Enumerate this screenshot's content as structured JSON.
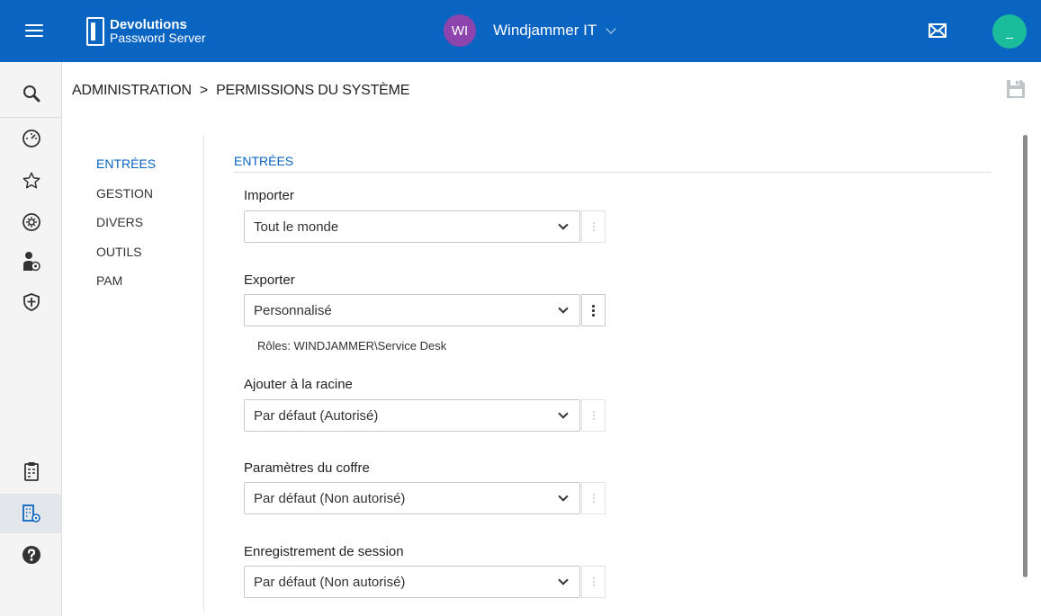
{
  "header": {
    "logo_line1": "Devolutions",
    "logo_line2": "Password Server",
    "org_initials": "WI",
    "org_name": "Windjammer IT"
  },
  "icons": {
    "menu": "hamburger-menu-icon",
    "mail": "mail-icon",
    "search": "search-icon",
    "dashboard": "dashboard-icon",
    "favorites": "star-icon",
    "settings": "gear-icon",
    "users": "user-settings-icon",
    "security": "shield-icon",
    "reports": "clipboard-icon",
    "administration": "building-gear-icon",
    "help": "help-icon",
    "save": "save-icon"
  },
  "breadcrumb": {
    "part1": "ADMINISTRATION",
    "separator": ">",
    "part2": "PERMISSIONS DU SYSTÈME"
  },
  "subnav": {
    "items": [
      "ENTRÉES",
      "GESTION",
      "DIVERS",
      "OUTILS",
      "PAM"
    ],
    "active": "ENTRÉES"
  },
  "section": {
    "title": "ENTRÉES"
  },
  "fields": [
    {
      "label": "Importer",
      "value": "Tout le monde",
      "menu_enabled": false
    },
    {
      "label": "Exporter",
      "value": "Personnalisé",
      "menu_enabled": true,
      "note": "Rôles: WINDJAMMER\\Service Desk"
    },
    {
      "label": "Ajouter à la racine",
      "value": "Par défaut (Autorisé)",
      "menu_enabled": false
    },
    {
      "label": "Paramètres du coffre",
      "value": "Par défaut (Non autorisé)",
      "menu_enabled": false
    },
    {
      "label": "Enregistrement de session",
      "value": "Par défaut (Non autorisé)",
      "menu_enabled": false
    }
  ],
  "colors": {
    "topbar": "#0a64c2",
    "accent": "#0a64c2",
    "org_avatar": "#8e44ad",
    "user_avatar": "#1abc9c"
  }
}
